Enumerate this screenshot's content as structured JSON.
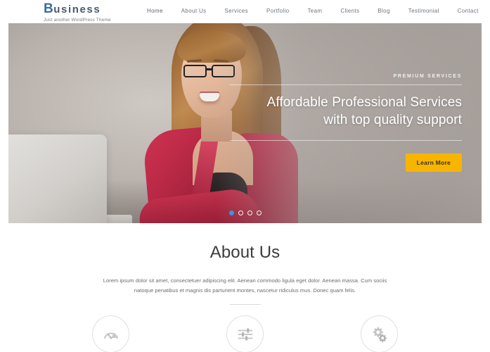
{
  "header": {
    "brand": {
      "initial": "B",
      "rest": "usiness",
      "tagline": "Just another WordPress Theme"
    },
    "nav": [
      {
        "label": "Home",
        "active": true
      },
      {
        "label": "About Us",
        "active": false
      },
      {
        "label": "Services",
        "active": false
      },
      {
        "label": "Portfolio",
        "active": false
      },
      {
        "label": "Team",
        "active": false
      },
      {
        "label": "Clients",
        "active": false
      },
      {
        "label": "Blog",
        "active": false
      },
      {
        "label": "Testimonial",
        "active": false
      },
      {
        "label": "Contact",
        "active": false
      }
    ]
  },
  "hero": {
    "eyebrow": "PREMIUM SERVICES",
    "headline_line1": "Affordable Professional Services",
    "headline_line2": "with top quality support",
    "cta_label": "Learn More",
    "dots": [
      {
        "active": true
      },
      {
        "active": false
      },
      {
        "active": false
      },
      {
        "active": false
      }
    ],
    "colors": {
      "cta_background": "#f7b500",
      "cta_text": "#3a3120",
      "active_dot": "#2f9ae0"
    }
  },
  "about": {
    "title": "About Us",
    "paragraph": "Lorem ipsum dolor sit amet, consectetuer adipiscing elit. Aenean commodo ligula eget dolor. Aenean massa. Cum sociis natoque penatibus et magnis dis parturient montes, nascetur ridiculus mus. Donec quam felis.",
    "features": [
      {
        "icon": "speedometer-icon"
      },
      {
        "icon": "sliders-icon"
      },
      {
        "icon": "gears-icon"
      }
    ]
  },
  "theme": {
    "brand_blue": "#3d6b9e",
    "accent_yellow": "#f7b500",
    "text_dark": "#3b3b3b",
    "text_muted": "#6d6d6d"
  }
}
